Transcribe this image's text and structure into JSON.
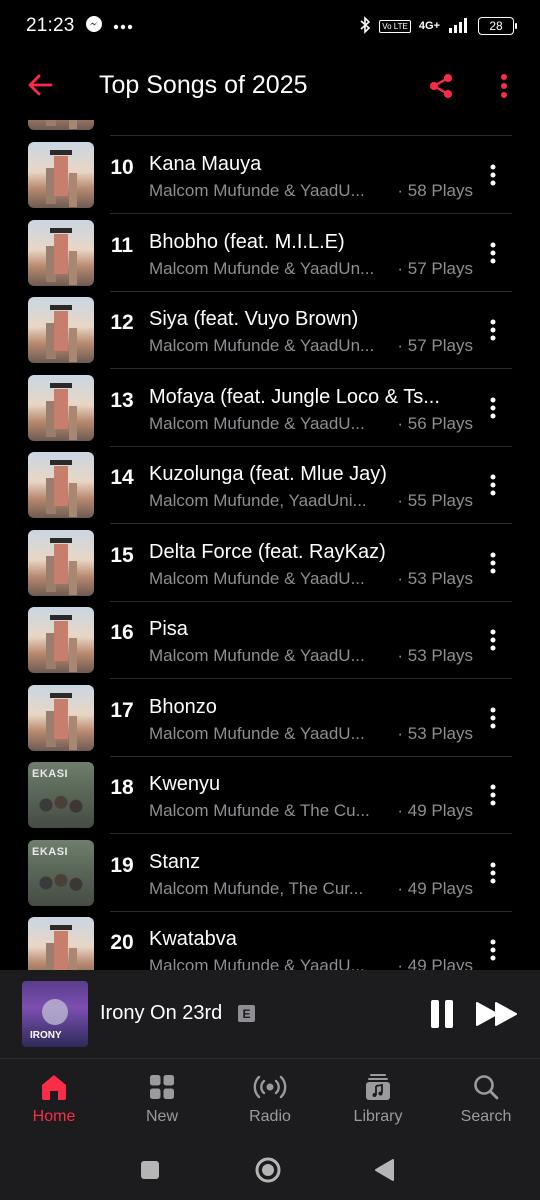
{
  "status": {
    "time": "21:23",
    "battery": "28",
    "network": "4G+",
    "volte": "Vo LTE"
  },
  "header": {
    "title": "Top Songs of 2025"
  },
  "colors": {
    "accent": "#fa2d48",
    "secondary_text": "#8e8e93",
    "background": "#000000",
    "bar_background": "#1c1c1e"
  },
  "songs": [
    {
      "rank": "10",
      "title": "Kana Mauya",
      "artist": "Malcom Mufunde & YaadU...",
      "plays": "· 58 Plays",
      "art": "city"
    },
    {
      "rank": "11",
      "title": "Bhobho (feat. M.I.L.E)",
      "artist": "Malcom Mufunde & YaadUn...",
      "plays": "· 57 Plays",
      "art": "city"
    },
    {
      "rank": "12",
      "title": "Siya (feat. Vuyo Brown)",
      "artist": "Malcom Mufunde & YaadUn...",
      "plays": "· 57 Plays",
      "art": "city"
    },
    {
      "rank": "13",
      "title": "Mofaya (feat. Jungle Loco & Ts...",
      "artist": "Malcom Mufunde & YaadU...",
      "plays": "· 56 Plays",
      "art": "city"
    },
    {
      "rank": "14",
      "title": "Kuzolunga (feat. Mlue Jay)",
      "artist": "Malcom Mufunde, YaadUni...",
      "plays": "· 55 Plays",
      "art": "city"
    },
    {
      "rank": "15",
      "title": "Delta Force (feat. RayKaz)",
      "artist": "Malcom Mufunde & YaadU...",
      "plays": "· 53 Plays",
      "art": "city"
    },
    {
      "rank": "16",
      "title": "Pisa",
      "artist": "Malcom Mufunde & YaadU...",
      "plays": "· 53 Plays",
      "art": "city"
    },
    {
      "rank": "17",
      "title": "Bhonzo",
      "artist": "Malcom Mufunde & YaadU...",
      "plays": "· 53 Plays",
      "art": "city"
    },
    {
      "rank": "18",
      "title": "Kwenyu",
      "artist": "Malcom Mufunde & The Cu...",
      "plays": "· 49 Plays",
      "art": "kasi"
    },
    {
      "rank": "19",
      "title": "Stanz",
      "artist": "Malcom Mufunde, The Cur...",
      "plays": "· 49 Plays",
      "art": "kasi"
    },
    {
      "rank": "20",
      "title": "Kwatabva",
      "artist": "Malcom Mufunde & YaadU...",
      "plays": "· 49 Plays",
      "art": "city"
    }
  ],
  "now_playing": {
    "title": "Irony On 23rd",
    "explicit_badge": "E"
  },
  "tabs": [
    {
      "label": "Home",
      "icon": "home-icon",
      "active": true
    },
    {
      "label": "New",
      "icon": "grid-icon",
      "active": false
    },
    {
      "label": "Radio",
      "icon": "radio-icon",
      "active": false
    },
    {
      "label": "Library",
      "icon": "library-icon",
      "active": false
    },
    {
      "label": "Search",
      "icon": "search-icon",
      "active": false
    }
  ]
}
